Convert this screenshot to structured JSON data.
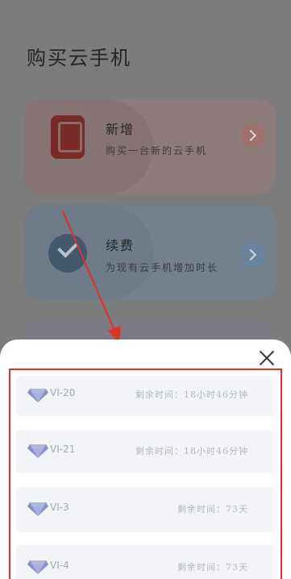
{
  "page": {
    "title": "购买云手机"
  },
  "cards": [
    {
      "title": "新增",
      "subtitle": "购买一台新的云手机",
      "icon": "phone-icon"
    },
    {
      "title": "续费",
      "subtitle": "为现有云手机增加时长",
      "icon": "check-icon"
    }
  ],
  "sheet": {
    "items": [
      {
        "name": "VI-20",
        "remain": "剩余时间：18小时46分钟"
      },
      {
        "name": "VI-21",
        "remain": "剩余时间：18小时46分钟"
      },
      {
        "name": "VI-3",
        "remain": "剩余时间：73天"
      },
      {
        "name": "VI-4",
        "remain": "剩余时间：73天"
      }
    ]
  },
  "colors": {
    "annotation": "#e03131",
    "gem": "#8a92c9",
    "item_bg": "#f3f4f8"
  }
}
